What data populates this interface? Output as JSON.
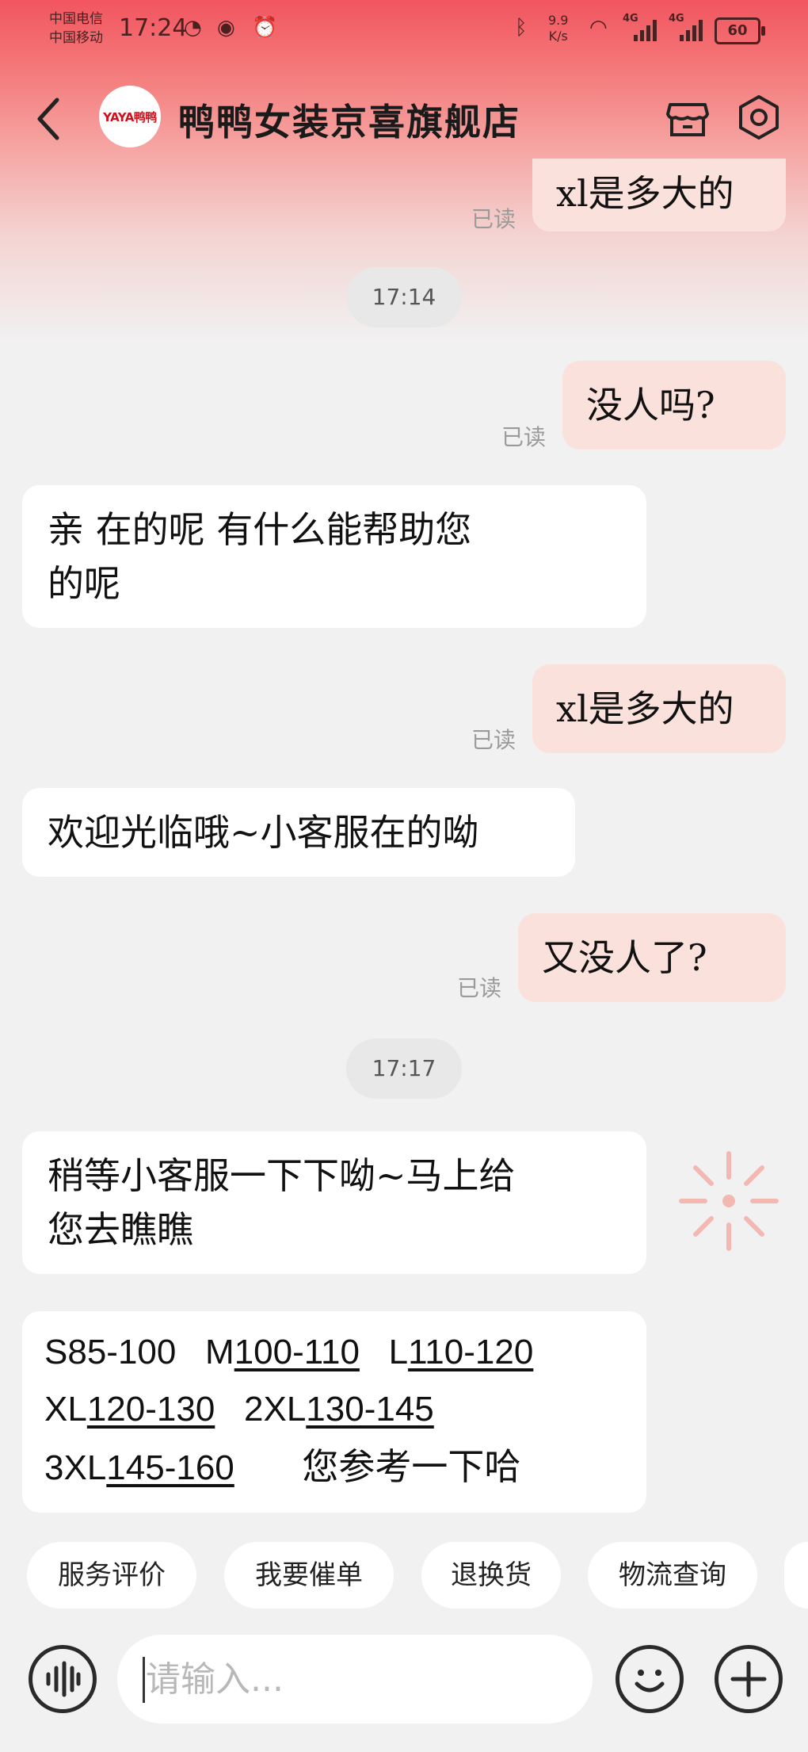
{
  "status_bar": {
    "carrier_1": "中国电信",
    "carrier_2": "中国移动",
    "time": "17:24",
    "net_speed_value": "9.9",
    "net_speed_unit": "K/s",
    "network_1": "4G",
    "network_2": "4G",
    "battery": "60"
  },
  "header": {
    "back_icon": "chevron-left-icon",
    "logo_text": "YAYA鸭鸭",
    "shop_name": "鸭鸭女装京喜旗舰店",
    "store_icon": "store-icon",
    "settings_icon": "settings-hexagon-icon"
  },
  "messages": {
    "m1": {
      "text": "xl是多大的",
      "read": "已读"
    },
    "t1": "17:14",
    "m2": {
      "text": "没人吗?",
      "read": "已读"
    },
    "m3": {
      "line1": "亲  在的呢  有什么能帮助您",
      "line2": "的呢"
    },
    "m4": {
      "text": "xl是多大的",
      "read": "已读"
    },
    "m5": {
      "text": "欢迎光临哦~小客服在的呦"
    },
    "m6": {
      "text": "又没人了?",
      "read": "已读"
    },
    "t2": "17:17",
    "m7": {
      "line1": "稍等小客服一下下呦~马上给",
      "line2": "您去瞧瞧"
    },
    "m8": {
      "s": "S85-100",
      "m_label": "M",
      "m_range": "100-110",
      "l_label": "L",
      "l_range": "110-120",
      "xl_label": "XL",
      "xl_range": "120-130",
      "xxl_label": "2XL",
      "xxl_range": "130-145",
      "xxxl_label": "3XL",
      "xxxl_range": "145-160",
      "note": "您参考一下哈"
    }
  },
  "quick_replies": [
    "服务评价",
    "我要催单",
    "退换货",
    "物流查询"
  ],
  "input_bar": {
    "voice_icon": "voice-wave-icon",
    "placeholder": "请输入...",
    "emoji_icon": "smiley-icon",
    "plus_icon": "plus-icon"
  },
  "colors": {
    "header_red": "#f2555f",
    "outgoing_bubble": "#fbe1dc",
    "incoming_bubble": "#ffffff",
    "background": "#f1f1f1"
  }
}
